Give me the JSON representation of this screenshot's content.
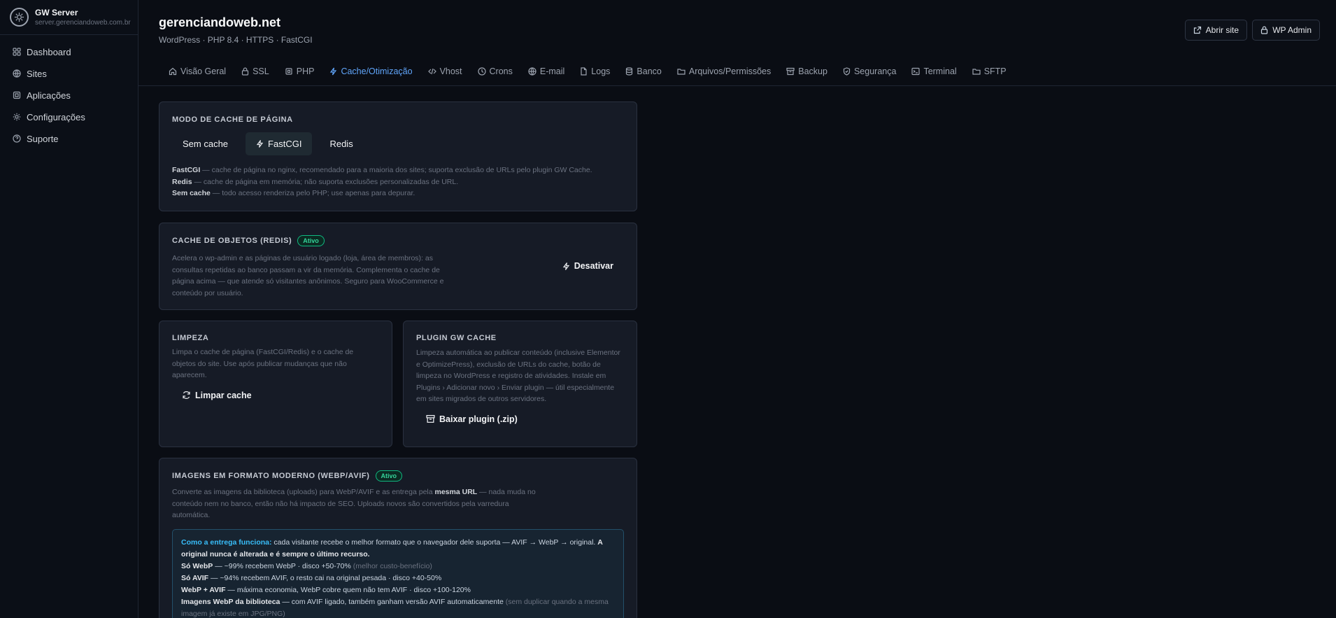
{
  "app": {
    "name": "GW Server",
    "host": "server.gerenciandoweb.com.br"
  },
  "sidebar": {
    "items": [
      {
        "label": "Dashboard",
        "icon": "grid-icon"
      },
      {
        "label": "Sites",
        "icon": "globe-icon"
      },
      {
        "label": "Aplicações",
        "icon": "box-icon"
      },
      {
        "label": "Configurações",
        "icon": "gear-icon"
      },
      {
        "label": "Suporte",
        "icon": "help-icon"
      }
    ]
  },
  "header": {
    "site_name": "gerenciandoweb.net",
    "site_meta": "WordPress · PHP 8.4 · HTTPS · FastCGI",
    "open_site_label": "Abrir site",
    "wp_admin_label": "WP Admin"
  },
  "tabs": [
    {
      "label": "Visão Geral",
      "icon": "home-icon"
    },
    {
      "label": "SSL",
      "icon": "lock-icon"
    },
    {
      "label": "PHP",
      "icon": "chip-icon"
    },
    {
      "label": "Cache/Otimização",
      "icon": "bolt-icon",
      "active": true
    },
    {
      "label": "Vhost",
      "icon": "code-icon"
    },
    {
      "label": "Crons",
      "icon": "clock-icon"
    },
    {
      "label": "E-mail",
      "icon": "globe-icon"
    },
    {
      "label": "Logs",
      "icon": "file-icon"
    },
    {
      "label": "Banco",
      "icon": "database-icon"
    },
    {
      "label": "Arquivos/Permissões",
      "icon": "folder-icon"
    },
    {
      "label": "Backup",
      "icon": "archive-icon"
    },
    {
      "label": "Segurança",
      "icon": "shield-icon"
    },
    {
      "label": "Terminal",
      "icon": "terminal-icon"
    },
    {
      "label": "SFTP",
      "icon": "folder-icon"
    }
  ],
  "page_cache": {
    "title": "Modo de cache de página",
    "options": [
      "Sem cache",
      "FastCGI",
      "Redis"
    ],
    "selected": "FastCGI",
    "desc": [
      {
        "term": "FastCGI",
        "text": " — cache de página no nginx, recomendado para a maioria dos sites; suporta exclusão de URLs pelo plugin GW Cache."
      },
      {
        "term": "Redis",
        "text": " — cache de página em memória; não suporta exclusões personalizadas de URL."
      },
      {
        "term": "Sem cache",
        "text": " — todo acesso renderiza pelo PHP; use apenas para depurar."
      }
    ]
  },
  "object_cache": {
    "title": "Cache de objetos (Redis)",
    "badge": "Ativo",
    "desc": "Acelera o wp-admin e as páginas de usuário logado (loja, área de membros): as consultas repetidas ao banco passam a vir da memória. Complementa o cache de página acima — que atende só visitantes anônimos. Seguro para WooCommerce e conteúdo por usuário.",
    "action_label": "Desativar"
  },
  "cleanup": {
    "title": "Limpeza",
    "desc": "Limpa o cache de página (FastCGI/Redis) e o cache de objetos do site. Use após publicar mudanças que não aparecem.",
    "action_label": "Limpar cache"
  },
  "plugin": {
    "title": "Plugin GW Cache",
    "desc": "Limpeza automática ao publicar conteúdo (inclusive Elementor e OptimizePress), exclusão de URLs do cache, botão de limpeza no WordPress e registro de atividades. Instale em Plugins › Adicionar novo › Enviar plugin — útil especialmente em sites migrados de outros servidores.",
    "action_label": "Baixar plugin (.zip)"
  },
  "images": {
    "title": "Imagens em formato moderno (WebP/AVIF)",
    "badge": "Ativo",
    "desc_pre": "Converte as imagens da biblioteca (uploads) para WebP/AVIF e as entrega pela ",
    "desc_bold": "mesma URL",
    "desc_post": " — nada muda no conteúdo nem no banco, então não há impacto de SEO. Uploads novos são convertidos pela varredura automática.",
    "info": {
      "lead": "Como a entrega funciona:",
      "lead_text": " cada visitante recebe o melhor formato que o navegador dele suporta — AVIF → WebP → original. ",
      "lead_bold": "A original nunca é alterada e é sempre o último recurso.",
      "lines": [
        {
          "term": "Só WebP",
          "text": " — ~99% recebem WebP · disco +50-70% ",
          "dim": "(melhor custo-benefício)"
        },
        {
          "term": "Só AVIF",
          "text": " — ~94% recebem AVIF, o resto cai na original pesada · disco +40-50%",
          "dim": ""
        },
        {
          "term": "WebP + AVIF",
          "text": " — máxima economia, WebP cobre quem não tem AVIF · disco +100-120%",
          "dim": ""
        },
        {
          "term": "Imagens WebP da biblioteca",
          "text": " — com AVIF ligado, também ganham versão AVIF automaticamente ",
          "dim": "(sem duplicar quando a mesma imagem já existe em JPG/PNG)"
        }
      ]
    }
  },
  "colors": {
    "accent": "#60a5fa",
    "success": "#34d399",
    "info": "#38bdf8"
  }
}
